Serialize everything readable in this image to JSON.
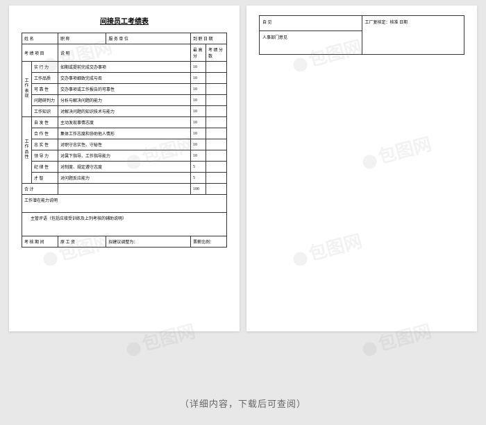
{
  "title": "间接员工考绩表",
  "header": {
    "name_label": "姓 名",
    "position_label": "职 称",
    "dept_label": "服 务 单 位",
    "hire_date_label": "到 职 日 期"
  },
  "columns": {
    "item": "考 绩 项 目",
    "desc": "说   明",
    "max": "最 高 分",
    "score": "考 绩 分 数"
  },
  "groups": [
    {
      "label": "工作表现",
      "rows": [
        {
          "item": "实 行 力",
          "desc": "如期或提前完成交办事项",
          "max": "10"
        },
        {
          "item": "工作品质",
          "desc": "交办事项细致完成与否",
          "max": "10"
        },
        {
          "item": "可 靠 性",
          "desc": "交办事项或工作报告的可靠性",
          "max": "10"
        },
        {
          "item": "问题研判力",
          "desc": "分析与解决问题的能力",
          "max": "10"
        },
        {
          "item": "工作知识",
          "desc": "对解决问题的知识技术与能力",
          "max": "10"
        }
      ]
    },
    {
      "label": "工作品性",
      "rows": [
        {
          "item": "自 发 性",
          "desc": "主动发现事情志度",
          "max": "10"
        },
        {
          "item": "合 作 性",
          "desc": "集体工作志度和协助他人情形",
          "max": "10"
        },
        {
          "item": "忠 实 性",
          "desc": "对职守忠实性、守秘性",
          "max": "10"
        },
        {
          "item": "领 导 力",
          "desc": "对属下指导、工作指导能力",
          "max": "10"
        },
        {
          "item": "纪 律 性",
          "desc": "对制度、规定遵守志度",
          "max": "5"
        },
        {
          "item": "才   智",
          "desc": "对问题反应能力",
          "max": "5"
        }
      ]
    }
  ],
  "total": {
    "label": "合 计",
    "max": "100"
  },
  "potential": "工作潜在能力说明",
  "manager_comment": "主管评语（包括应接受训练及上列考核的辅助说明）",
  "footer_row": {
    "period": "考 核 期 间",
    "wage": "原 工 资",
    "adjust": "拟建议调整为：",
    "ratio": "晋薪比例："
  },
  "page2": {
    "self": "自 见",
    "factory": "工厂复核定：核准 日期",
    "hr": "人事部门意见"
  },
  "footer_note": "（详细内容，下载后可查阅）",
  "watermark_text": "包图网"
}
